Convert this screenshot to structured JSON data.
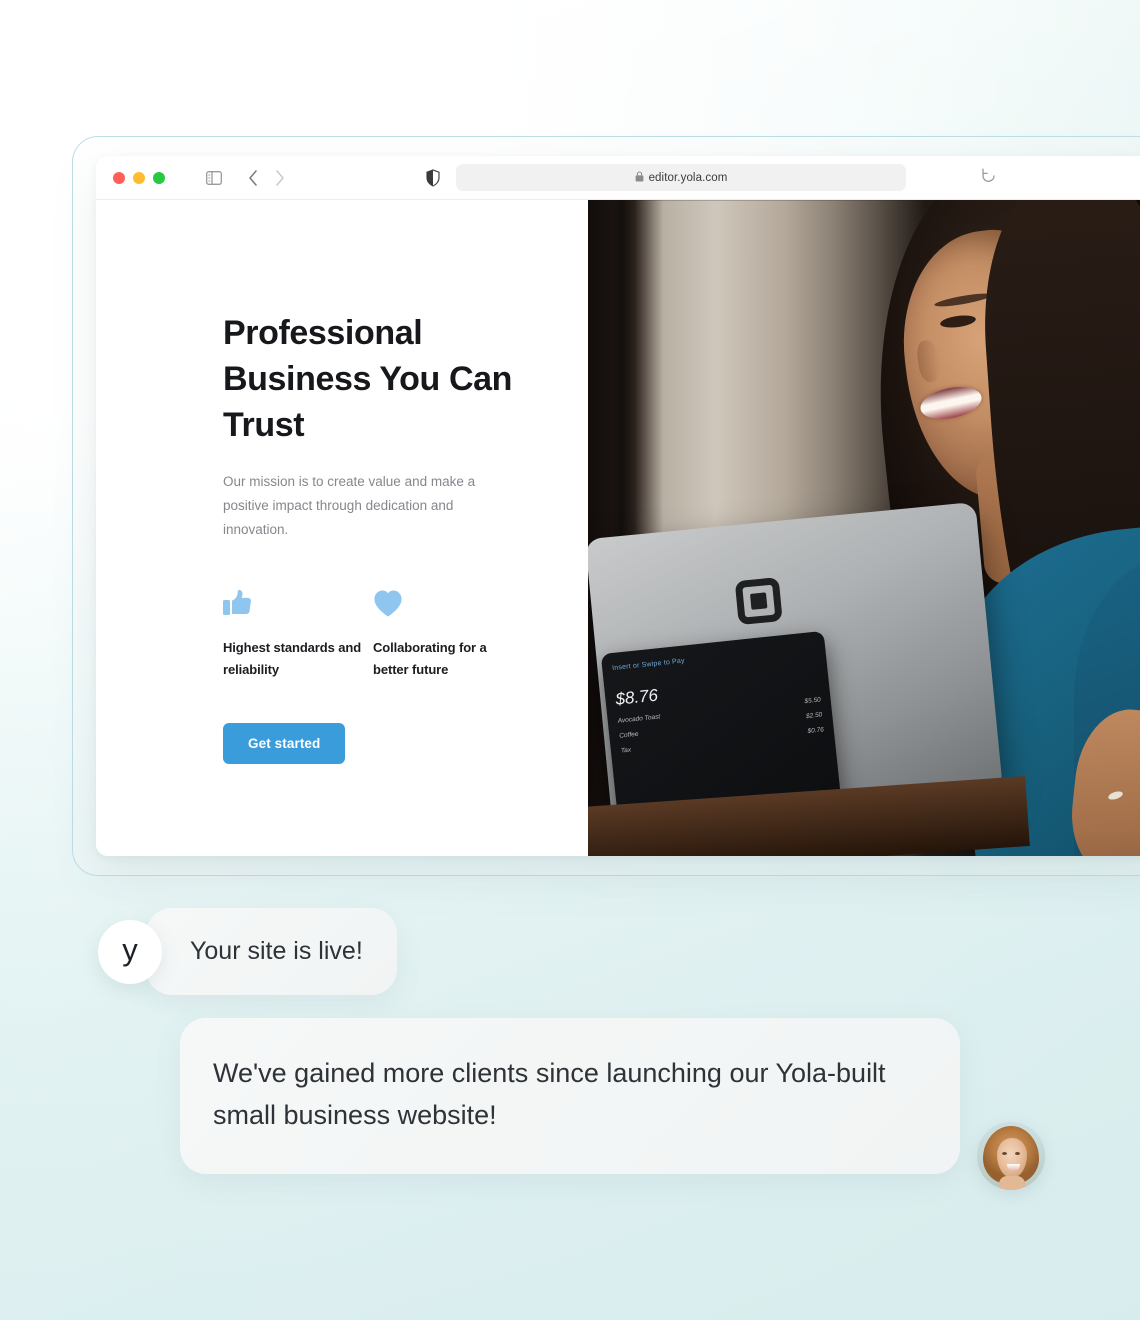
{
  "browser": {
    "traffic_lights": [
      "close",
      "minimize",
      "zoom"
    ],
    "sidebar_toggle_icon": "sidebar-toggle-icon",
    "back_icon": "chevron-left-icon",
    "forward_icon": "chevron-right-icon",
    "shield_icon": "shield-privacy-icon",
    "lock_icon": "lock-icon",
    "url": "editor.yola.com",
    "reload_icon": "reload-icon"
  },
  "site": {
    "hero": {
      "title": "Professional Business You Can Trust",
      "subtitle": "Our mission is to create value and make a positive impact through dedication and innovation.",
      "features": [
        {
          "icon": "thumbs-up-icon",
          "label": "Highest standards and reliability"
        },
        {
          "icon": "heart-icon",
          "label": "Collaborating for a better future"
        }
      ],
      "cta_label": "Get started",
      "accent_color": "#3b9cdb",
      "feature_icon_color": "#8fc6ef"
    },
    "photo": {
      "alt": "Smiling woman in blue top holding a Square point-of-sale tablet",
      "pos_screen": {
        "prompt": "Insert or Swipe to Pay",
        "total": "$8.76",
        "items": [
          {
            "name": "Avocado Toast",
            "price": "$5.50"
          },
          {
            "name": "Coffee",
            "price": "$2.50"
          },
          {
            "name": "Tax",
            "price": "$0.76"
          }
        ]
      }
    }
  },
  "chat": {
    "messages": [
      {
        "avatar": "yola-logo-avatar",
        "avatar_letter": "y",
        "text": "Your site is live!"
      },
      {
        "avatar": "customer-photo-avatar",
        "text": "We've gained more clients since launching our Yola-built small business website!"
      }
    ]
  },
  "theme": {
    "background_start": "#ffffff",
    "background_end": "#dcefee",
    "frame_border": "#bddde8",
    "bubble_background": "#f3f6f6",
    "text_dark": "#16181c",
    "text_muted": "#85878c"
  }
}
